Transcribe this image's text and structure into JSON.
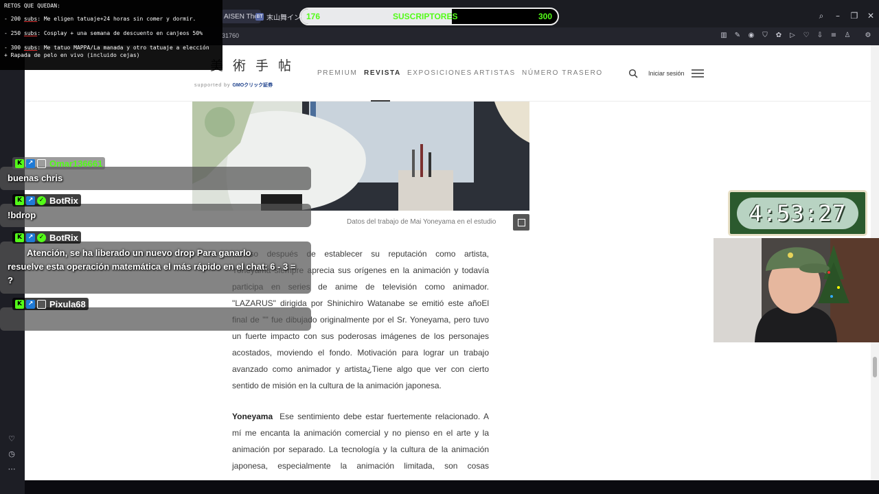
{
  "browser": {
    "tabs": [
      {
        "label": "AISEN The"
      },
      {
        "favicon": "BT",
        "label": "末山舞インタビ"
      }
    ],
    "url_fragment": "31760"
  },
  "site": {
    "logo_jp": "美術手帖",
    "logo_sub": "supported by",
    "logo_sponsor": "GMOクリック証券",
    "nav": [
      "PREMIUM",
      "REVISTA",
      "EXPOSICIONES",
      "ARTISTAS",
      "NÚMERO TRASERO"
    ],
    "login": "Iniciar sesión"
  },
  "article": {
    "caption": "Datos del trabajo de Mai Yoneyama en el estudio",
    "para1": [
      "Incluso después de establecer su reputación como artista,",
      "Yoneyama siempre aprecia sus orígenes en la animación y todavía",
      "participa en series de anime de televisión como animador.",
      "\"LAZARUS\" dirigida por Shinichiro Watanabe se emitió este añoEl",
      "final de \"\" fue dibujado originalmente por el Sr. Yoneyama, pero tuvo",
      "un fuerte impacto con sus poderosas imágenes de los personajes",
      "acostados, moviendo el fondo. Motivación para lograr un trabajo",
      "avanzado como animador y artista¿Tiene algo que ver con cierto",
      "sentido de misión en la cultura de la animación japonesa."
    ],
    "speaker": "Yoneyama",
    "para2": [
      "Ese sentimiento debe estar fuertemente relacionado. A",
      "mí me encanta la animación comercial y no pienso en el arte y la",
      "animación por separado. La tecnología y la cultura de la animación",
      "japonesa, especialmente la animación limitada, son cosas"
    ]
  },
  "overlay": {
    "retos_title": "RETOS QUE QUEDAN:",
    "retos": [
      {
        "n": "- 200",
        "subs": "subs",
        "text": ": Me eligen tatuaje+24 horas sin comer y dormir."
      },
      {
        "n": "- 250",
        "subs": "subs",
        "text": ": Cosplay + una semana de descuento en canjeos 50%"
      },
      {
        "n": "- 300",
        "subs": "subs",
        "text": ": Me tatuo MAPPA/La manada y otro tatuaje a elección"
      },
      {
        "n": "",
        "subs": "",
        "text": "+ Rapada de pelo en vivo (incluido cejas)"
      }
    ],
    "sub_goal": {
      "current": "176",
      "label": "SUSCRIPTORES",
      "target": "300",
      "progress": 0.587
    },
    "timer": "4:53:27",
    "chat": [
      {
        "user": "Omar136661",
        "message": "buenas chris"
      },
      {
        "user": "BotRix",
        "message": "!bdrop"
      },
      {
        "user": "BotRix",
        "message_lines": [
          "Atención, se ha liberado un nuevo drop        Para ganarlo",
          "resuelve esta operación matemática el más rápido en el chat: 6 - 3 =",
          "?"
        ]
      },
      {
        "user": "Pixula68",
        "message": ""
      }
    ]
  },
  "colors": {
    "kick_green": "#53fc18",
    "sub_blue": "#1f7ad6",
    "page_text": "#3a3a3a"
  }
}
